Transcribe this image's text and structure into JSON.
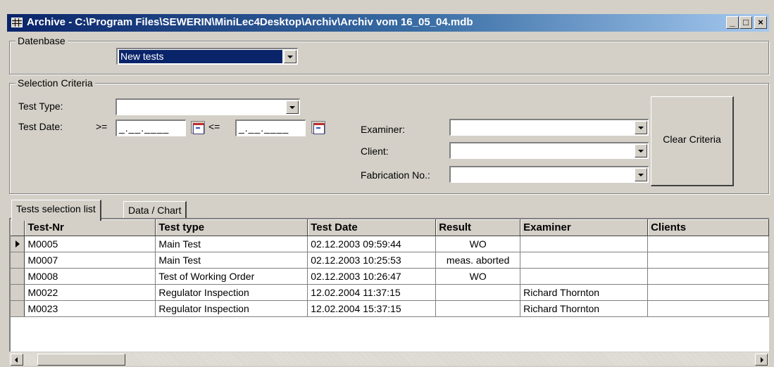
{
  "window": {
    "title": "Archive - C:\\Program Files\\SEWERIN\\MiniLec4Desktop\\Archiv\\Archiv vom 16_05_04.mdb",
    "minimize": "_",
    "maximize": "□",
    "close": "×"
  },
  "database": {
    "group_label": "Datenbase",
    "selected": "New tests"
  },
  "criteria": {
    "group_label": "Selection Criteria",
    "test_type_label": "Test Type:",
    "test_type_value": "",
    "test_date_label": "Test Date:",
    "ge": ">=",
    "le": "<=",
    "date_from": "_.__.____",
    "date_to": "_.__.____",
    "examiner_label": "Examiner:",
    "examiner_value": "",
    "client_label": "Client:",
    "client_value": "",
    "fabrication_label": "Fabrication No.:",
    "fabrication_value": "",
    "clear_button": "Clear Criteria"
  },
  "tabs": [
    {
      "label": "Tests selection list",
      "active": true
    },
    {
      "label": "Data / Chart",
      "active": false
    }
  ],
  "table": {
    "columns": [
      "Test-Nr",
      "Test type",
      "Test Date",
      "Result",
      "Examiner",
      "Clients"
    ],
    "rows": [
      {
        "current": true,
        "cells": [
          "M0005",
          "Main Test",
          "02.12.2003 09:59:44",
          "WO",
          "",
          ""
        ]
      },
      {
        "current": false,
        "cells": [
          "M0007",
          "Main Test",
          "02.12.2003 10:25:53",
          "meas. aborted",
          "",
          ""
        ]
      },
      {
        "current": false,
        "cells": [
          "M0008",
          "Test of Working Order",
          "02.12.2003 10:26:47",
          "WO",
          "",
          ""
        ]
      },
      {
        "current": false,
        "cells": [
          "M0022",
          "Regulator Inspection",
          "12.02.2004 11:37:15",
          "",
          "Richard Thornton",
          ""
        ]
      },
      {
        "current": false,
        "cells": [
          "M0023",
          "Regulator Inspection",
          "12.02.2004 15:37:15",
          "",
          "Richard Thornton",
          ""
        ]
      }
    ]
  }
}
